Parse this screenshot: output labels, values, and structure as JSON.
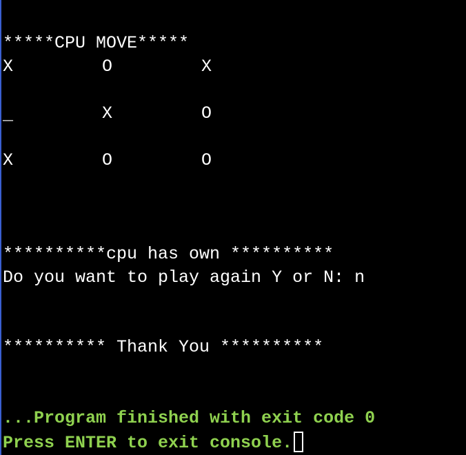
{
  "console": {
    "header": "*****CPU MOVE*****",
    "board": [
      [
        "X",
        "O",
        "X"
      ],
      [
        "_",
        "X",
        "O"
      ],
      [
        "X",
        "O",
        "O"
      ]
    ],
    "result": "**********cpu has own **********",
    "prompt": "Do you want to play again Y or N: n",
    "thanks": "********** Thank You **********",
    "exit_message": "...Program finished with exit code 0",
    "enter_message": "Press ENTER to exit console."
  },
  "colors": {
    "background": "#000000",
    "text": "#ffffff",
    "status": "#8fd14f"
  }
}
